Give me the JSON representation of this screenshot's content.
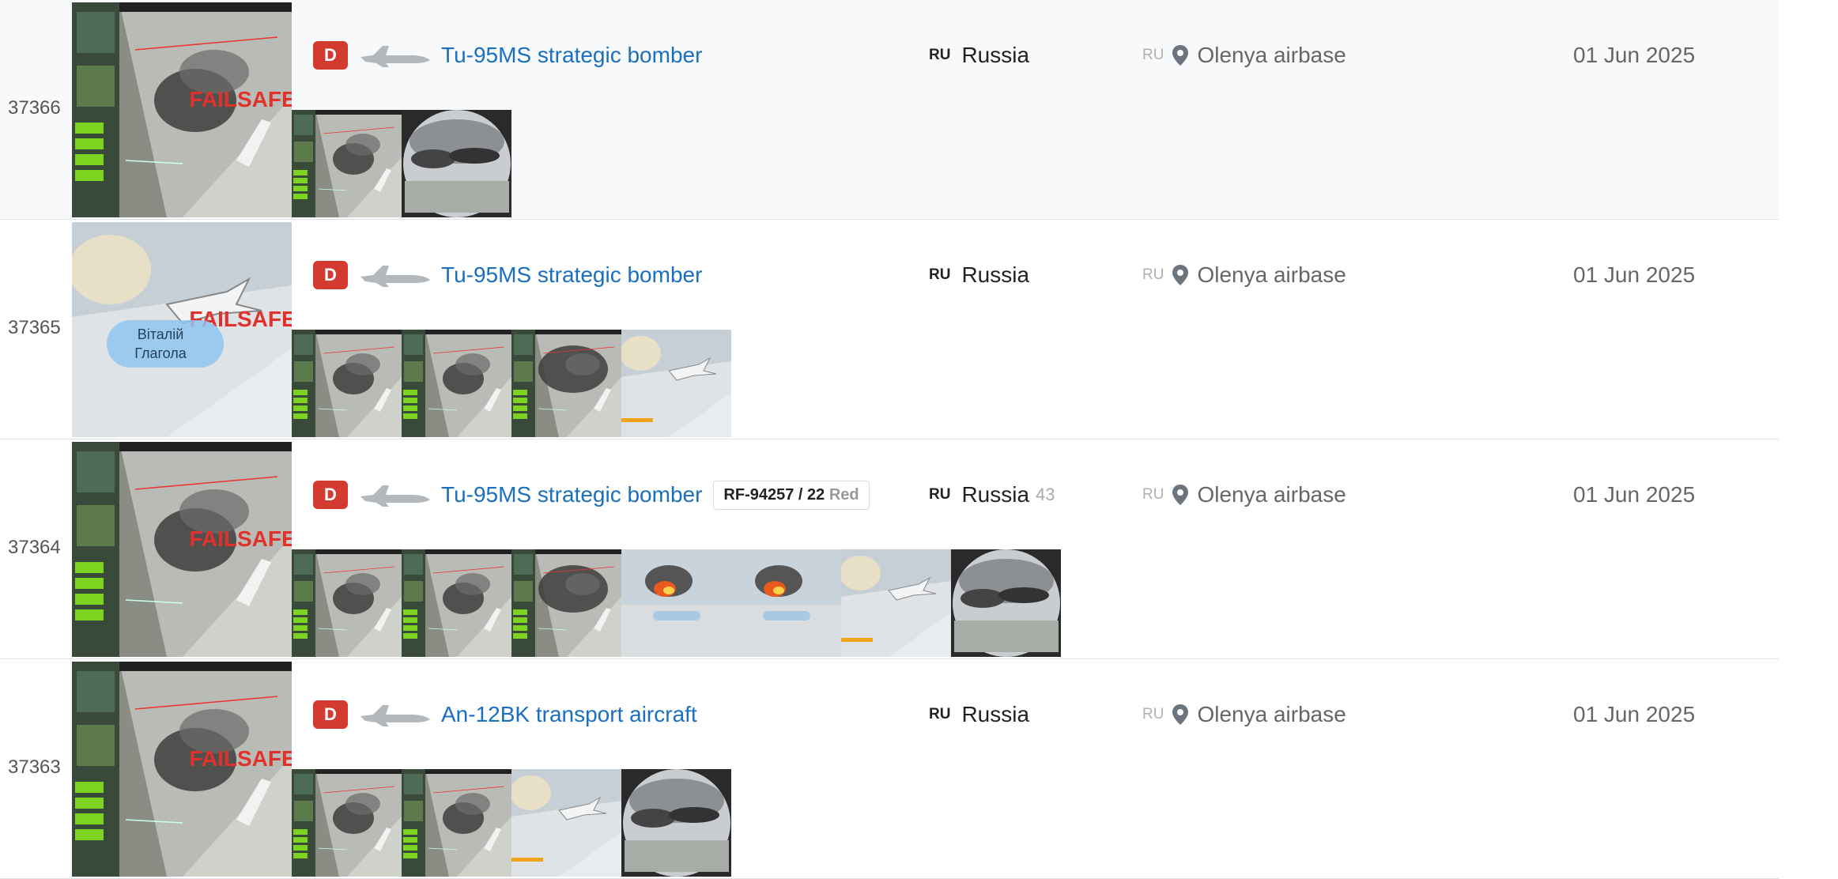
{
  "rows": [
    {
      "id": "37366",
      "badge": "D",
      "equipment": "Tu-95MS strategic bomber",
      "serial": "",
      "serial_suffix": "",
      "country_code": "RU",
      "country": "Russia",
      "country_count": "",
      "place_code": "RU",
      "place": "Olenya airbase",
      "date": "01 Jun 2025",
      "main_thumb": {
        "style": "hud",
        "overlay_text": "FAILSAFE"
      },
      "thumbs": [
        {
          "style": "hud-small"
        },
        {
          "style": "round-smoke"
        }
      ],
      "shaded": true
    },
    {
      "id": "37365",
      "badge": "D",
      "equipment": "Tu-95MS strategic bomber",
      "serial": "",
      "serial_suffix": "",
      "country_code": "RU",
      "country": "Russia",
      "country_count": "",
      "place_code": "RU",
      "place": "Olenya airbase",
      "date": "01 Jun 2025",
      "main_thumb": {
        "style": "bright",
        "overlay_text": "FAILSAFE",
        "watermark": "Віталій Глагола"
      },
      "thumbs": [
        {
          "style": "hud-small"
        },
        {
          "style": "hud-small"
        },
        {
          "style": "smoke"
        },
        {
          "style": "bright-small"
        }
      ],
      "shaded": false
    },
    {
      "id": "37364",
      "badge": "D",
      "equipment": "Tu-95MS strategic bomber",
      "serial": "RF-94257 / 22 ",
      "serial_suffix": "Red",
      "country_code": "RU",
      "country": "Russia",
      "country_count": "43",
      "place_code": "RU",
      "place": "Olenya airbase",
      "date": "01 Jun 2025",
      "main_thumb": {
        "style": "hud",
        "overlay_text": "FAILSAFE"
      },
      "thumbs": [
        {
          "style": "hud-small"
        },
        {
          "style": "hud-small"
        },
        {
          "style": "smoke"
        },
        {
          "style": "fire"
        },
        {
          "style": "fire"
        },
        {
          "style": "bright-small"
        },
        {
          "style": "round-smoke"
        }
      ],
      "shaded": false
    },
    {
      "id": "37363",
      "badge": "D",
      "equipment": "An-12BK transport aircraft",
      "serial": "",
      "serial_suffix": "",
      "country_code": "RU",
      "country": "Russia",
      "country_count": "",
      "place_code": "RU",
      "place": "Olenya airbase",
      "date": "01 Jun 2025",
      "main_thumb": {
        "style": "hud",
        "overlay_text": "FAILSAFE"
      },
      "thumbs": [
        {
          "style": "hud-small"
        },
        {
          "style": "hud-small"
        },
        {
          "style": "bright-small"
        },
        {
          "style": "round-smoke"
        }
      ],
      "shaded": false
    }
  ],
  "colors": {
    "badge": "#d43b30",
    "link": "#1a6fbf",
    "row_shade": "#f8f9fa",
    "border": "#dee2e6"
  },
  "icons": {
    "equipment_type": "plane-icon",
    "location": "map-pin-icon"
  }
}
